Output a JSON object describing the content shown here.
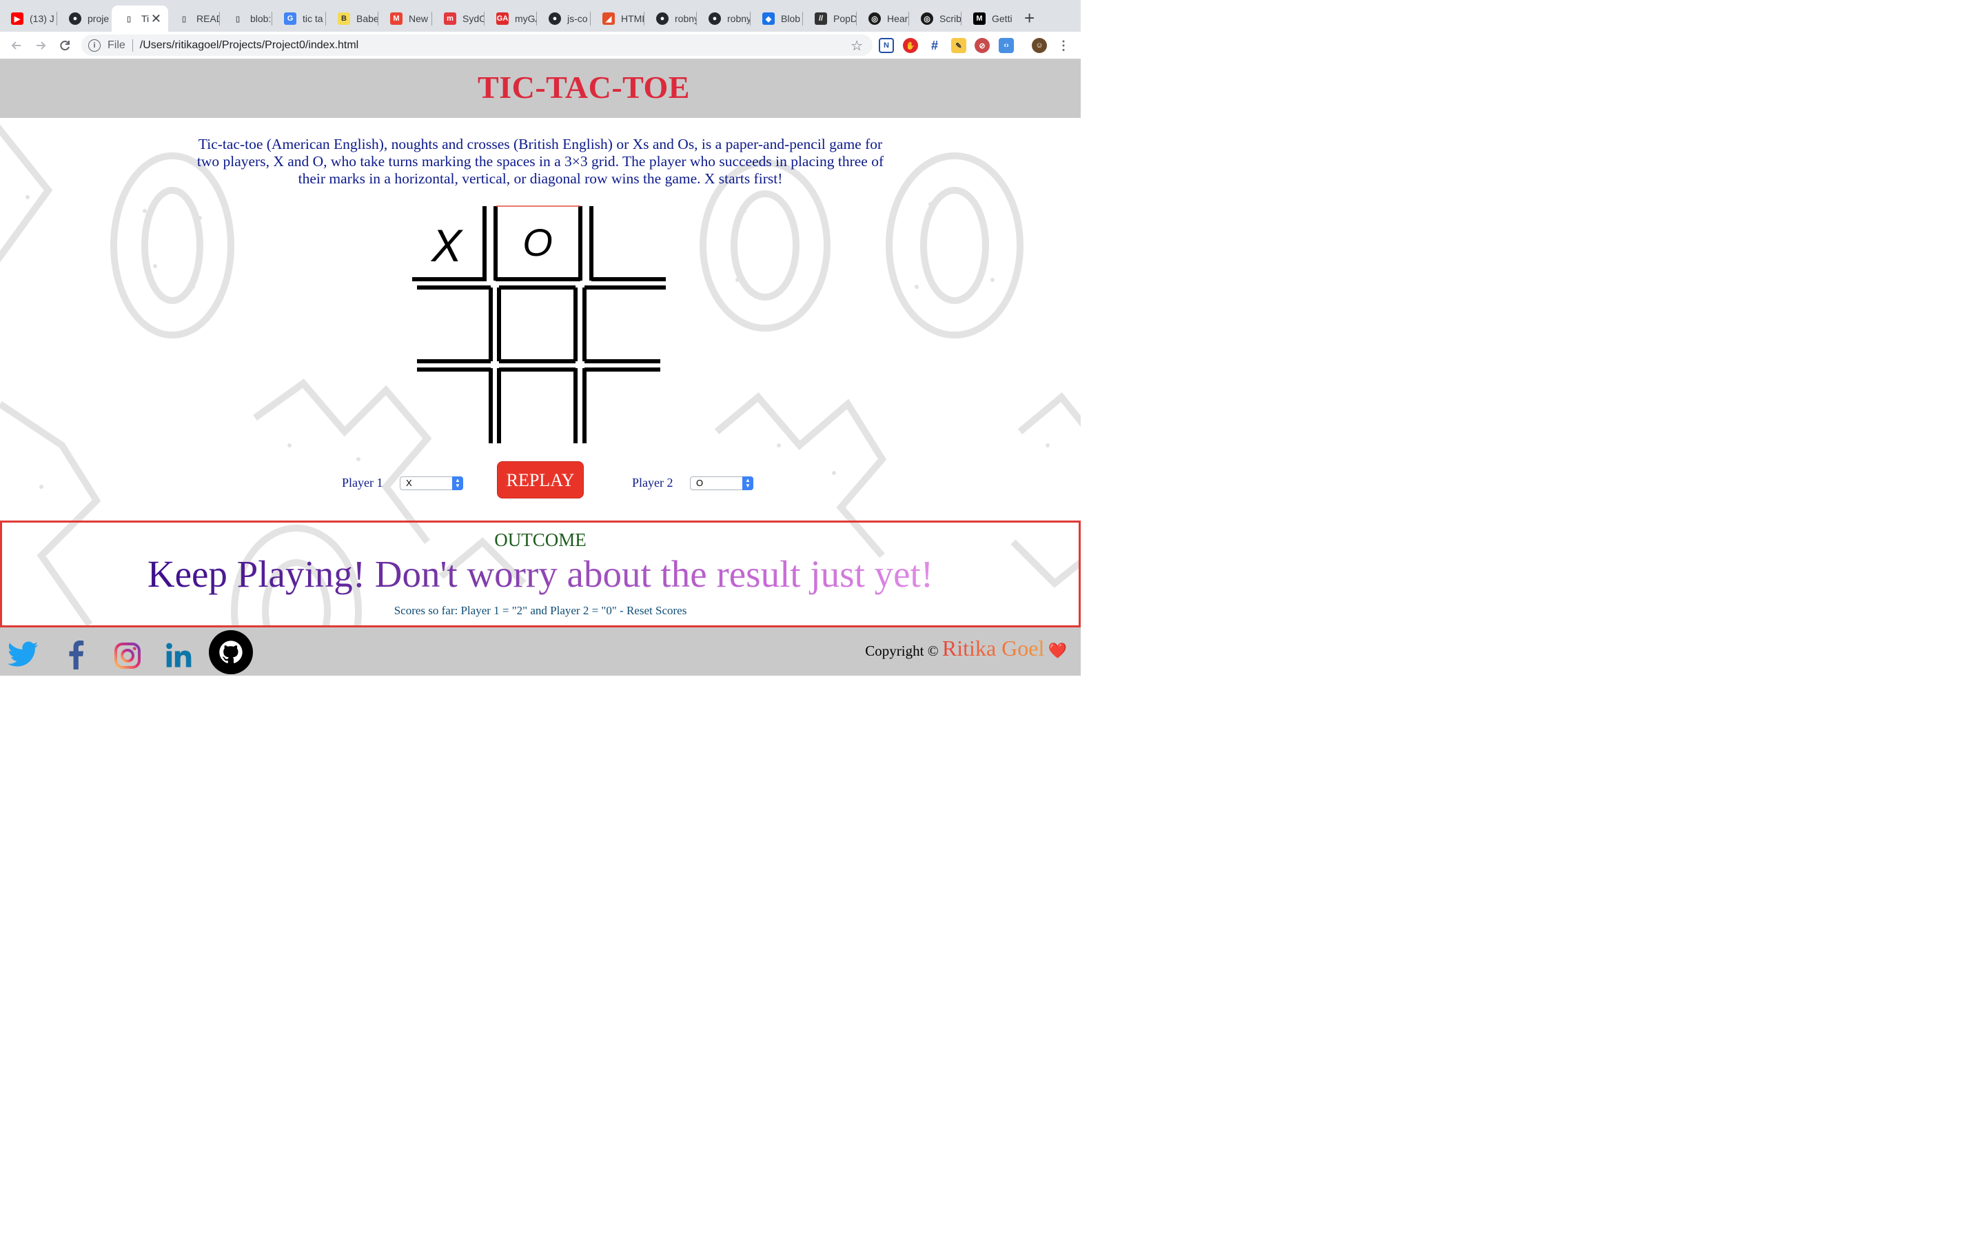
{
  "browser": {
    "tabs": [
      {
        "title": "(13) J",
        "icon": "youtube-icon",
        "color": "#ff0000"
      },
      {
        "title": "proje",
        "icon": "github-icon",
        "color": "#24292e"
      },
      {
        "title": "Ti",
        "icon": "page-icon",
        "color": "#5f6368",
        "active": true
      },
      {
        "title": "READ",
        "icon": "page-icon",
        "color": "#5f6368"
      },
      {
        "title": "blob:",
        "icon": "page-icon",
        "color": "#5f6368"
      },
      {
        "title": "tic ta",
        "icon": "google-icon",
        "color": "#4285f4"
      },
      {
        "title": "Babel",
        "icon": "babel-icon",
        "color": "#f5da55"
      },
      {
        "title": "New",
        "icon": "gmail-icon",
        "color": "#ea4335"
      },
      {
        "title": "SydC",
        "icon": "meetup-icon",
        "color": "#e0393e"
      },
      {
        "title": "myGA",
        "icon": "ga-icon",
        "color": "#e02b2b"
      },
      {
        "title": "js-co",
        "icon": "github-icon",
        "color": "#24292e"
      },
      {
        "title": "HTML",
        "icon": "html-icon",
        "color": "#e34f26"
      },
      {
        "title": "robny",
        "icon": "github-icon",
        "color": "#24292e"
      },
      {
        "title": "robny",
        "icon": "github-icon",
        "color": "#24292e"
      },
      {
        "title": "Blob",
        "icon": "blob-icon",
        "color": "#1a73e8"
      },
      {
        "title": "PopD",
        "icon": "popd-icon",
        "color": "#333333"
      },
      {
        "title": "Heart",
        "icon": "scribd-icon",
        "color": "#1a1a1a"
      },
      {
        "title": "Scrib",
        "icon": "scribd-icon",
        "color": "#1a1a1a"
      },
      {
        "title": "Getti",
        "icon": "medium-icon",
        "color": "#000000"
      }
    ],
    "address": {
      "scheme": "File",
      "path": "/Users/ritikagoel/Projects/Project0/index.html"
    }
  },
  "page": {
    "title": "TIC-TAC-TOE",
    "intro": "Tic-tac-toe (American English), noughts and crosses (British English) or Xs and Os, is a paper-and-pencil game for two players, X and O, who take turns marking the spaces in a 3×3 grid. The player who succeeds in placing three of their marks in a horizontal, vertical, or diagonal row wins the game. X starts first!",
    "board": [
      [
        "X",
        "O",
        ""
      ],
      [
        "",
        "",
        ""
      ],
      [
        "",
        "",
        ""
      ]
    ],
    "player1_label": "Player 1",
    "player1_value": "X",
    "player2_label": "Player 2",
    "player2_value": "O",
    "replay_label": "REPLAY",
    "outcome_heading": "OUTCOME",
    "outcome_message": "Keep Playing! Don't worry about the result just yet!",
    "scores_text": "Scores so far: Player 1 = \"2\" and Player 2 = \"0\" - Reset Scores",
    "copyright_prefix": "Copyright ©",
    "copyright_author": "Ritika Goel",
    "copyright_heart": "❤️",
    "social_icons": [
      "twitter-icon",
      "facebook-icon",
      "instagram-icon",
      "linkedin-icon",
      "github-icon"
    ]
  },
  "colors": {
    "title": "#dc2a3d",
    "intro": "#0c1a8a",
    "replay": "#e83428",
    "outcome_border": "#e03a36",
    "outcome_heading": "#1d5c1d"
  }
}
